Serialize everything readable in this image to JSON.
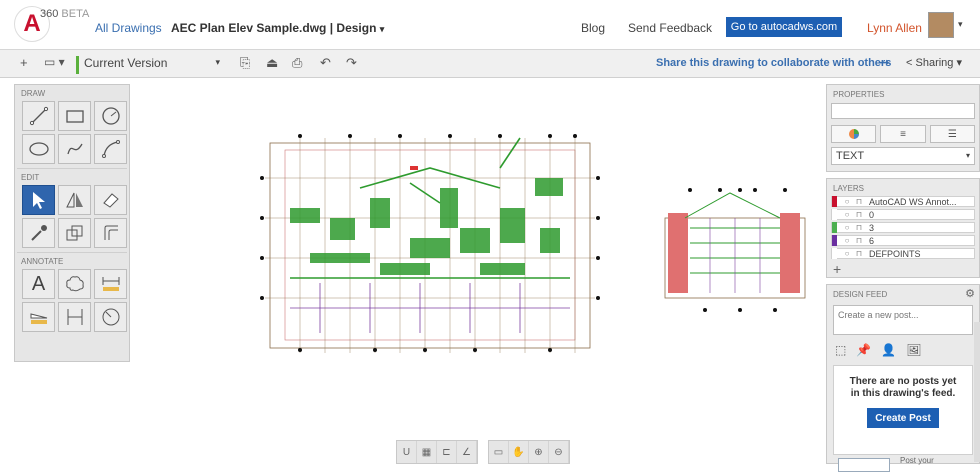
{
  "header": {
    "brand": "360",
    "beta": "BETA",
    "all_drawings": "All Drawings",
    "doc_title": "AEC Plan Elev Sample.dwg | Design",
    "blog": "Blog",
    "send_feedback": "Send Feedback",
    "goto_button": "Go to autocadws.com",
    "user_name": "Lynn Allen"
  },
  "toolbar": {
    "version": "Current Version",
    "share_text": "Share this drawing to collaborate with others",
    "sharing": "Sharing"
  },
  "left_panel": {
    "draw_label": "DRAW",
    "edit_label": "EDIT",
    "annotate_label": "ANNOTATE",
    "draw_tools": [
      "line-icon",
      "rectangle-icon",
      "circle-icon",
      "ellipse-icon",
      "spline-icon",
      "arc-icon"
    ],
    "edit_tools": [
      "select-icon",
      "mirror-icon",
      "erase-icon",
      "eyedropper-icon",
      "copy-icon",
      "offset-icon"
    ],
    "annotate_tools": [
      "text-icon",
      "cloud-icon",
      "dimension-icon",
      "leader-icon",
      "vertical-dimension-icon",
      "radius-icon"
    ],
    "text_tool_glyph": "A"
  },
  "properties": {
    "label": "PROPERTIES",
    "type_value": "TEXT"
  },
  "layers": {
    "label": "LAYERS",
    "rows": [
      {
        "name": "AutoCAD WS Annot...",
        "color": "#c8102e"
      },
      {
        "name": "0",
        "color": "#ffffff"
      },
      {
        "name": "3",
        "color": "#4caf50"
      },
      {
        "name": "6",
        "color": "#6a2fa0"
      },
      {
        "name": "DEFPOINTS",
        "color": "#ffffff"
      }
    ],
    "add": "+"
  },
  "design_feed": {
    "label": "DESIGN FEED",
    "post_placeholder": "Create a new post...",
    "empty_message": "There are no posts yet in this drawing's feed.",
    "create_post": "Create Post",
    "post_your": "Post your"
  },
  "bottom_tools": {
    "snap_glyph": "U"
  },
  "colors": {
    "accent_blue": "#1d5fb3",
    "link_blue": "#3a6fb0",
    "user_orange": "#d2542c",
    "plan_green": "#2e9b2e"
  }
}
